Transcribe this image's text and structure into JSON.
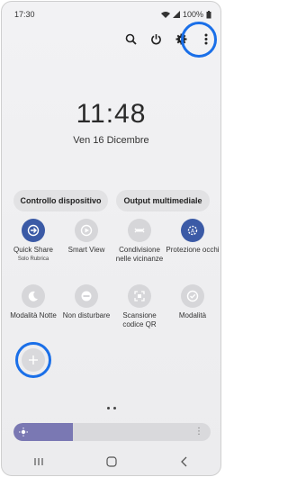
{
  "status": {
    "time": "17:30",
    "battery": "100%"
  },
  "clock": {
    "time": "11:48",
    "date": "Ven 16 Dicembre"
  },
  "pills": {
    "device_control": "Controllo dispositivo",
    "media_output": "Output multimediale"
  },
  "tiles": [
    {
      "label": "Quick Share",
      "sub": "Solo Rubrica",
      "active": true,
      "icon": "quick-share-icon"
    },
    {
      "label": "Smart View",
      "sub": "",
      "active": false,
      "icon": "smart-view-icon"
    },
    {
      "label": "Condivisione nelle vicinanze",
      "sub": "",
      "active": false,
      "icon": "nearby-share-icon"
    },
    {
      "label": "Protezione occhi",
      "sub": "",
      "active": true,
      "icon": "eye-comfort-icon"
    },
    {
      "label": "Modalità Notte",
      "sub": "",
      "active": false,
      "icon": "moon-icon"
    },
    {
      "label": "Non disturbare",
      "sub": "",
      "active": false,
      "icon": "do-not-disturb-icon"
    },
    {
      "label": "Scansione codice QR",
      "sub": "",
      "active": false,
      "icon": "qr-scan-icon"
    },
    {
      "label": "Modalità",
      "sub": "",
      "active": false,
      "icon": "modes-icon"
    }
  ],
  "brightness": {
    "level": 0.3
  },
  "colors": {
    "accent": "#3b5aa6",
    "highlight": "#1a6fe8",
    "brightness_fill": "#7a78b3"
  }
}
